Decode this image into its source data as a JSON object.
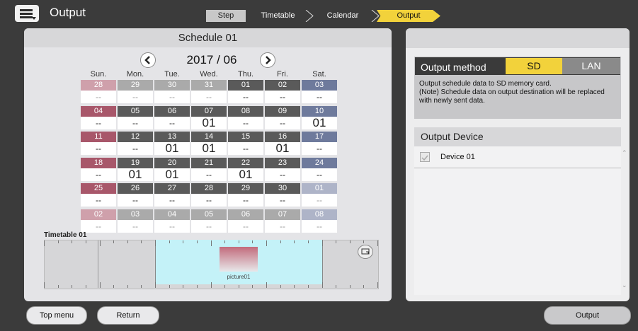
{
  "header": {
    "title": "Output",
    "step_label": "Step",
    "crumbs": [
      "Timetable",
      "Calendar",
      "Output"
    ],
    "active_crumb_color": "#f2d23b"
  },
  "schedule": {
    "title": "Schedule 01",
    "month": "2017 / 06",
    "weekdays": [
      "Sun.",
      "Mon.",
      "Tue.",
      "Wed.",
      "Thu.",
      "Fri.",
      "Sat."
    ],
    "weeks": [
      [
        {
          "d": "28",
          "v": "--",
          "t": "prev"
        },
        {
          "d": "29",
          "v": "--",
          "t": "prev"
        },
        {
          "d": "30",
          "v": "--",
          "t": "prev"
        },
        {
          "d": "31",
          "v": "--",
          "t": "prev"
        },
        {
          "d": "01",
          "v": "--",
          "t": "cur"
        },
        {
          "d": "02",
          "v": "--",
          "t": "cur"
        },
        {
          "d": "03",
          "v": "--",
          "t": "cur"
        }
      ],
      [
        {
          "d": "04",
          "v": "--",
          "t": "cur"
        },
        {
          "d": "05",
          "v": "--",
          "t": "cur"
        },
        {
          "d": "06",
          "v": "--",
          "t": "cur"
        },
        {
          "d": "07",
          "v": "01",
          "t": "cur"
        },
        {
          "d": "08",
          "v": "--",
          "t": "cur"
        },
        {
          "d": "09",
          "v": "--",
          "t": "cur"
        },
        {
          "d": "10",
          "v": "01",
          "t": "cur"
        }
      ],
      [
        {
          "d": "11",
          "v": "--",
          "t": "cur"
        },
        {
          "d": "12",
          "v": "--",
          "t": "cur"
        },
        {
          "d": "13",
          "v": "01",
          "t": "cur"
        },
        {
          "d": "14",
          "v": "01",
          "t": "cur"
        },
        {
          "d": "15",
          "v": "--",
          "t": "cur"
        },
        {
          "d": "16",
          "v": "01",
          "t": "cur"
        },
        {
          "d": "17",
          "v": "--",
          "t": "cur"
        }
      ],
      [
        {
          "d": "18",
          "v": "--",
          "t": "cur"
        },
        {
          "d": "19",
          "v": "01",
          "t": "cur"
        },
        {
          "d": "20",
          "v": "01",
          "t": "cur"
        },
        {
          "d": "21",
          "v": "--",
          "t": "cur"
        },
        {
          "d": "22",
          "v": "01",
          "t": "cur"
        },
        {
          "d": "23",
          "v": "--",
          "t": "cur"
        },
        {
          "d": "24",
          "v": "--",
          "t": "cur"
        }
      ],
      [
        {
          "d": "25",
          "v": "--",
          "t": "cur"
        },
        {
          "d": "26",
          "v": "--",
          "t": "cur"
        },
        {
          "d": "27",
          "v": "--",
          "t": "cur"
        },
        {
          "d": "28",
          "v": "--",
          "t": "cur"
        },
        {
          "d": "29",
          "v": "--",
          "t": "cur"
        },
        {
          "d": "30",
          "v": "--",
          "t": "cur"
        },
        {
          "d": "01",
          "v": "--",
          "t": "next"
        }
      ],
      [
        {
          "d": "02",
          "v": "--",
          "t": "next"
        },
        {
          "d": "03",
          "v": "--",
          "t": "next"
        },
        {
          "d": "04",
          "v": "--",
          "t": "next"
        },
        {
          "d": "05",
          "v": "--",
          "t": "next"
        },
        {
          "d": "06",
          "v": "--",
          "t": "next"
        },
        {
          "d": "07",
          "v": "--",
          "t": "next"
        },
        {
          "d": "08",
          "v": "--",
          "t": "next"
        }
      ]
    ],
    "colors": {
      "sun": "#a8576a",
      "sat": "#6e7a9c",
      "weekday": "#5a5a5a",
      "sun_faded": "#cfa0ab",
      "sat_faded": "#aeb4c8",
      "weekday_faded": "#aaaaaa"
    },
    "timetable_label": "Timetable 01",
    "picture_label": "picture01"
  },
  "output_method": {
    "label": "Output method",
    "sd_label": "SD",
    "lan_label": "LAN",
    "description": "Output schedule data to SD memory card.\n(Note) Schedule data on output destination will be replaced with newly sent data."
  },
  "output_device": {
    "header": "Output Device",
    "devices": [
      "Device 01"
    ]
  },
  "footer": {
    "top_menu": "Top menu",
    "return": "Return",
    "output": "Output"
  }
}
